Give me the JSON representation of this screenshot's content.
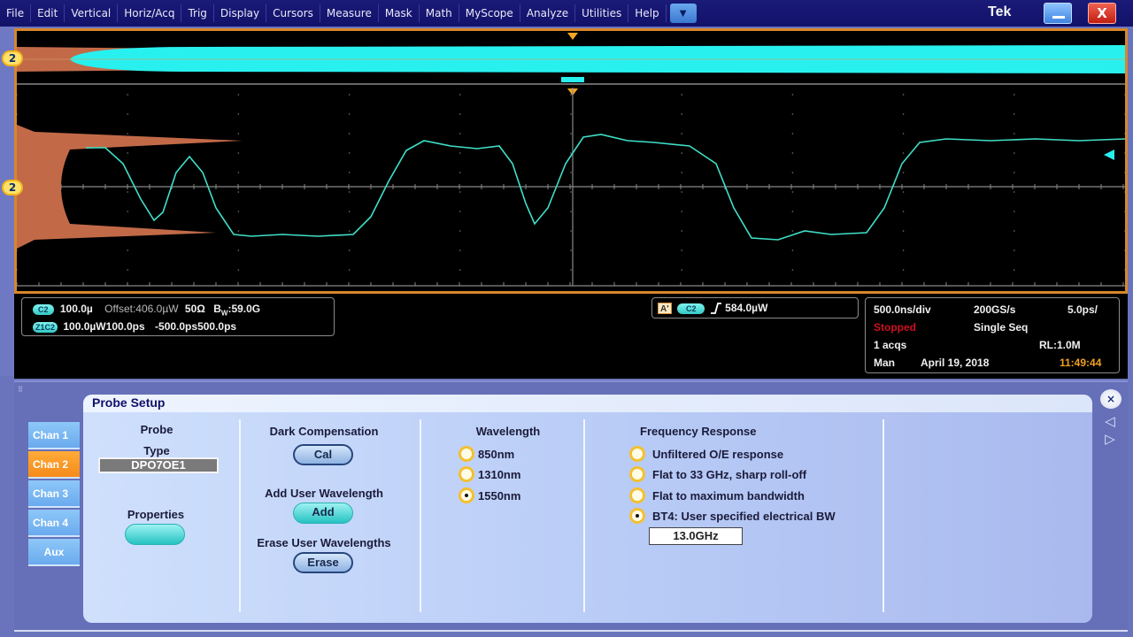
{
  "menubar": {
    "items": [
      "File",
      "Edit",
      "Vertical",
      "Horiz/Acq",
      "Trig",
      "Display",
      "Cursors",
      "Measure",
      "Mask",
      "Math",
      "MyScope",
      "Analyze",
      "Utilities",
      "Help"
    ],
    "dropdown_icon": "▼",
    "brand": "Tek",
    "minimize_icon": "minimize-icon",
    "close_label": "X"
  },
  "scope": {
    "channel_marker": "2",
    "colors": {
      "trace": "#3fe0c8",
      "histogram": "#c26a48",
      "overview_fill": "#28f0ee",
      "border": "#d8862a",
      "trigger_marker": "#f5a623"
    }
  },
  "readouts": {
    "channel": {
      "badge_c2": "C2",
      "scale": "100.0µ",
      "offset": "Offset:406.0µW",
      "impedance": "50Ω",
      "bw_prefix": "B",
      "bw_sub": "W",
      "bw_value": ":59.0G",
      "badge_zoom": "Z1C2",
      "zoom_scale": "100.0µW",
      "zoom_time": "100.0ps",
      "zoom_start": "-500.0ps",
      "zoom_end": "500.0ps"
    },
    "trigger": {
      "source_badge": "A'",
      "channel_badge": "C2",
      "slope_icon": "rising-edge-icon",
      "level": "584.0µW"
    },
    "acquisition": {
      "timebase": "500.0ns/div",
      "sample_rate": "200GS/s",
      "resolution": "5.0ps/",
      "state": "Stopped",
      "mode": "Single Seq",
      "acqs": "1 acqs",
      "record_length": "RL:1.0M",
      "trigger_mode": "Man",
      "date": "April 19, 2018",
      "time": "11:49:44"
    }
  },
  "panel": {
    "channel_tabs": [
      "Chan 1",
      "Chan 2",
      "Chan 3",
      "Chan 4",
      "Aux"
    ],
    "active_tab": "Chan 2",
    "dialog_title": "Probe Setup",
    "probe": {
      "heading": "Probe",
      "type_label": "Type",
      "type_value": "DPO7OE1",
      "properties_label": "Properties"
    },
    "dark_comp": {
      "heading": "Dark Compensation",
      "cal_button": "Cal",
      "add_heading": "Add User Wavelength",
      "add_button": "Add",
      "erase_heading": "Erase User Wavelengths",
      "erase_button": "Erase"
    },
    "wavelength": {
      "heading": "Wavelength",
      "options": [
        "850nm",
        "1310nm",
        "1550nm"
      ],
      "selected": "1550nm"
    },
    "frequency_response": {
      "heading": "Frequency Response",
      "options": [
        "Unfiltered O/E response",
        "Flat to 33 GHz, sharp roll-off",
        "Flat to maximum bandwidth",
        "BT4: User specified electrical BW"
      ],
      "selected": "BT4: User specified electrical BW",
      "bw_value": "13.0GHz"
    },
    "close_icon": "×",
    "prev_icon": "◁",
    "next_icon": "▷"
  }
}
